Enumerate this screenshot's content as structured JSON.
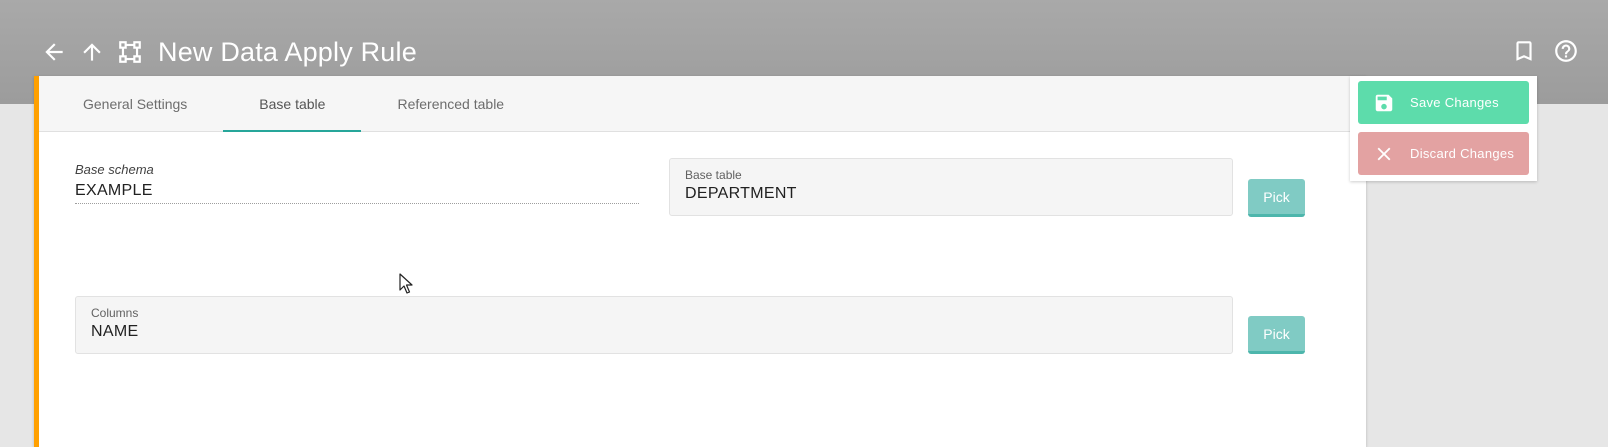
{
  "header": {
    "title": "New Data Apply Rule",
    "icons": [
      "arrow-left-icon",
      "arrow-up-icon",
      "vector-square-icon",
      "bookmark-icon",
      "help-circle-icon"
    ]
  },
  "tabs": [
    {
      "label": "General Settings",
      "active": false
    },
    {
      "label": "Base table",
      "active": true
    },
    {
      "label": "Referenced table",
      "active": false
    }
  ],
  "form": {
    "base_schema": {
      "label": "Base schema",
      "value": "EXAMPLE"
    },
    "base_table": {
      "label": "Base table",
      "value": "DEPARTMENT"
    },
    "columns": {
      "label": "Columns",
      "value": "NAME"
    },
    "pick_label": "Pick"
  },
  "actions": {
    "save_label": "Save Changes",
    "discard_label": "Discard Changes"
  },
  "colors": {
    "accent_orange": "#ffa000",
    "teal": "#26a69a",
    "save_green": "#5ddcab",
    "discard_red": "#e3a2a2",
    "pick_teal": "#80cbc4"
  }
}
